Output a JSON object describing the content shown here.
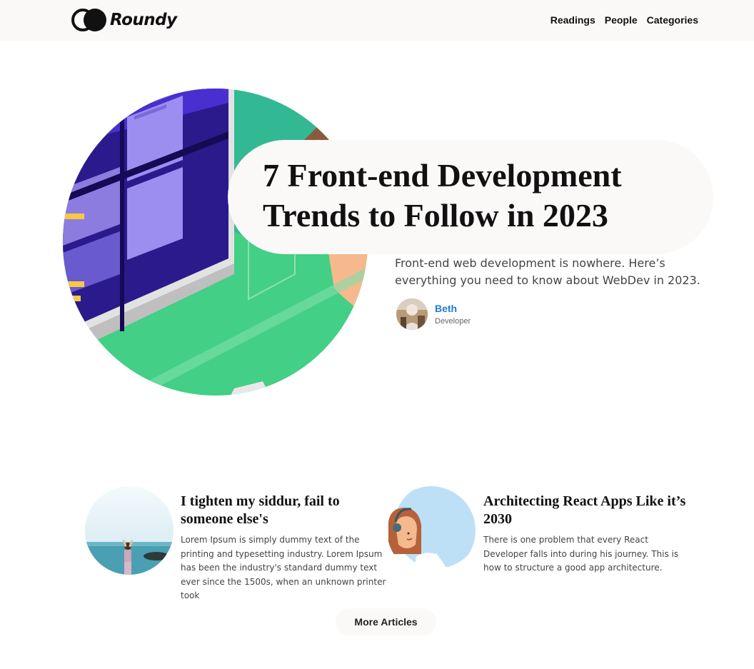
{
  "header": {
    "logo_text": "Roundy",
    "nav": [
      "Readings",
      "People",
      "Categories"
    ]
  },
  "hero": {
    "title": "7 Front-end Development Trends to Follow in 2023",
    "description": "Front-end web development is nowhere. Here’s everything you need to know about WebDev in 2023.",
    "author": {
      "name": "Beth",
      "role": "Developer"
    }
  },
  "articles": [
    {
      "title": "I tighten my siddur, fail to someone else's",
      "excerpt": "Lorem Ipsum is simply dummy text of the printing and typesetting industry. Lorem Ipsum has been the industry's standard dummy text ever since the 1500s, when an unknown printer took"
    },
    {
      "title": "Architecting React Apps Like it’s 2030",
      "excerpt": "There is one problem that every React Developer falls into during his journey. This is how to structure a good app architecture."
    }
  ],
  "more_button": "More Articles",
  "colors": {
    "accent": "#1e7bd8",
    "header_bg": "#fbf8f8",
    "green": "#43cf85",
    "purple": "#3a20a8"
  }
}
